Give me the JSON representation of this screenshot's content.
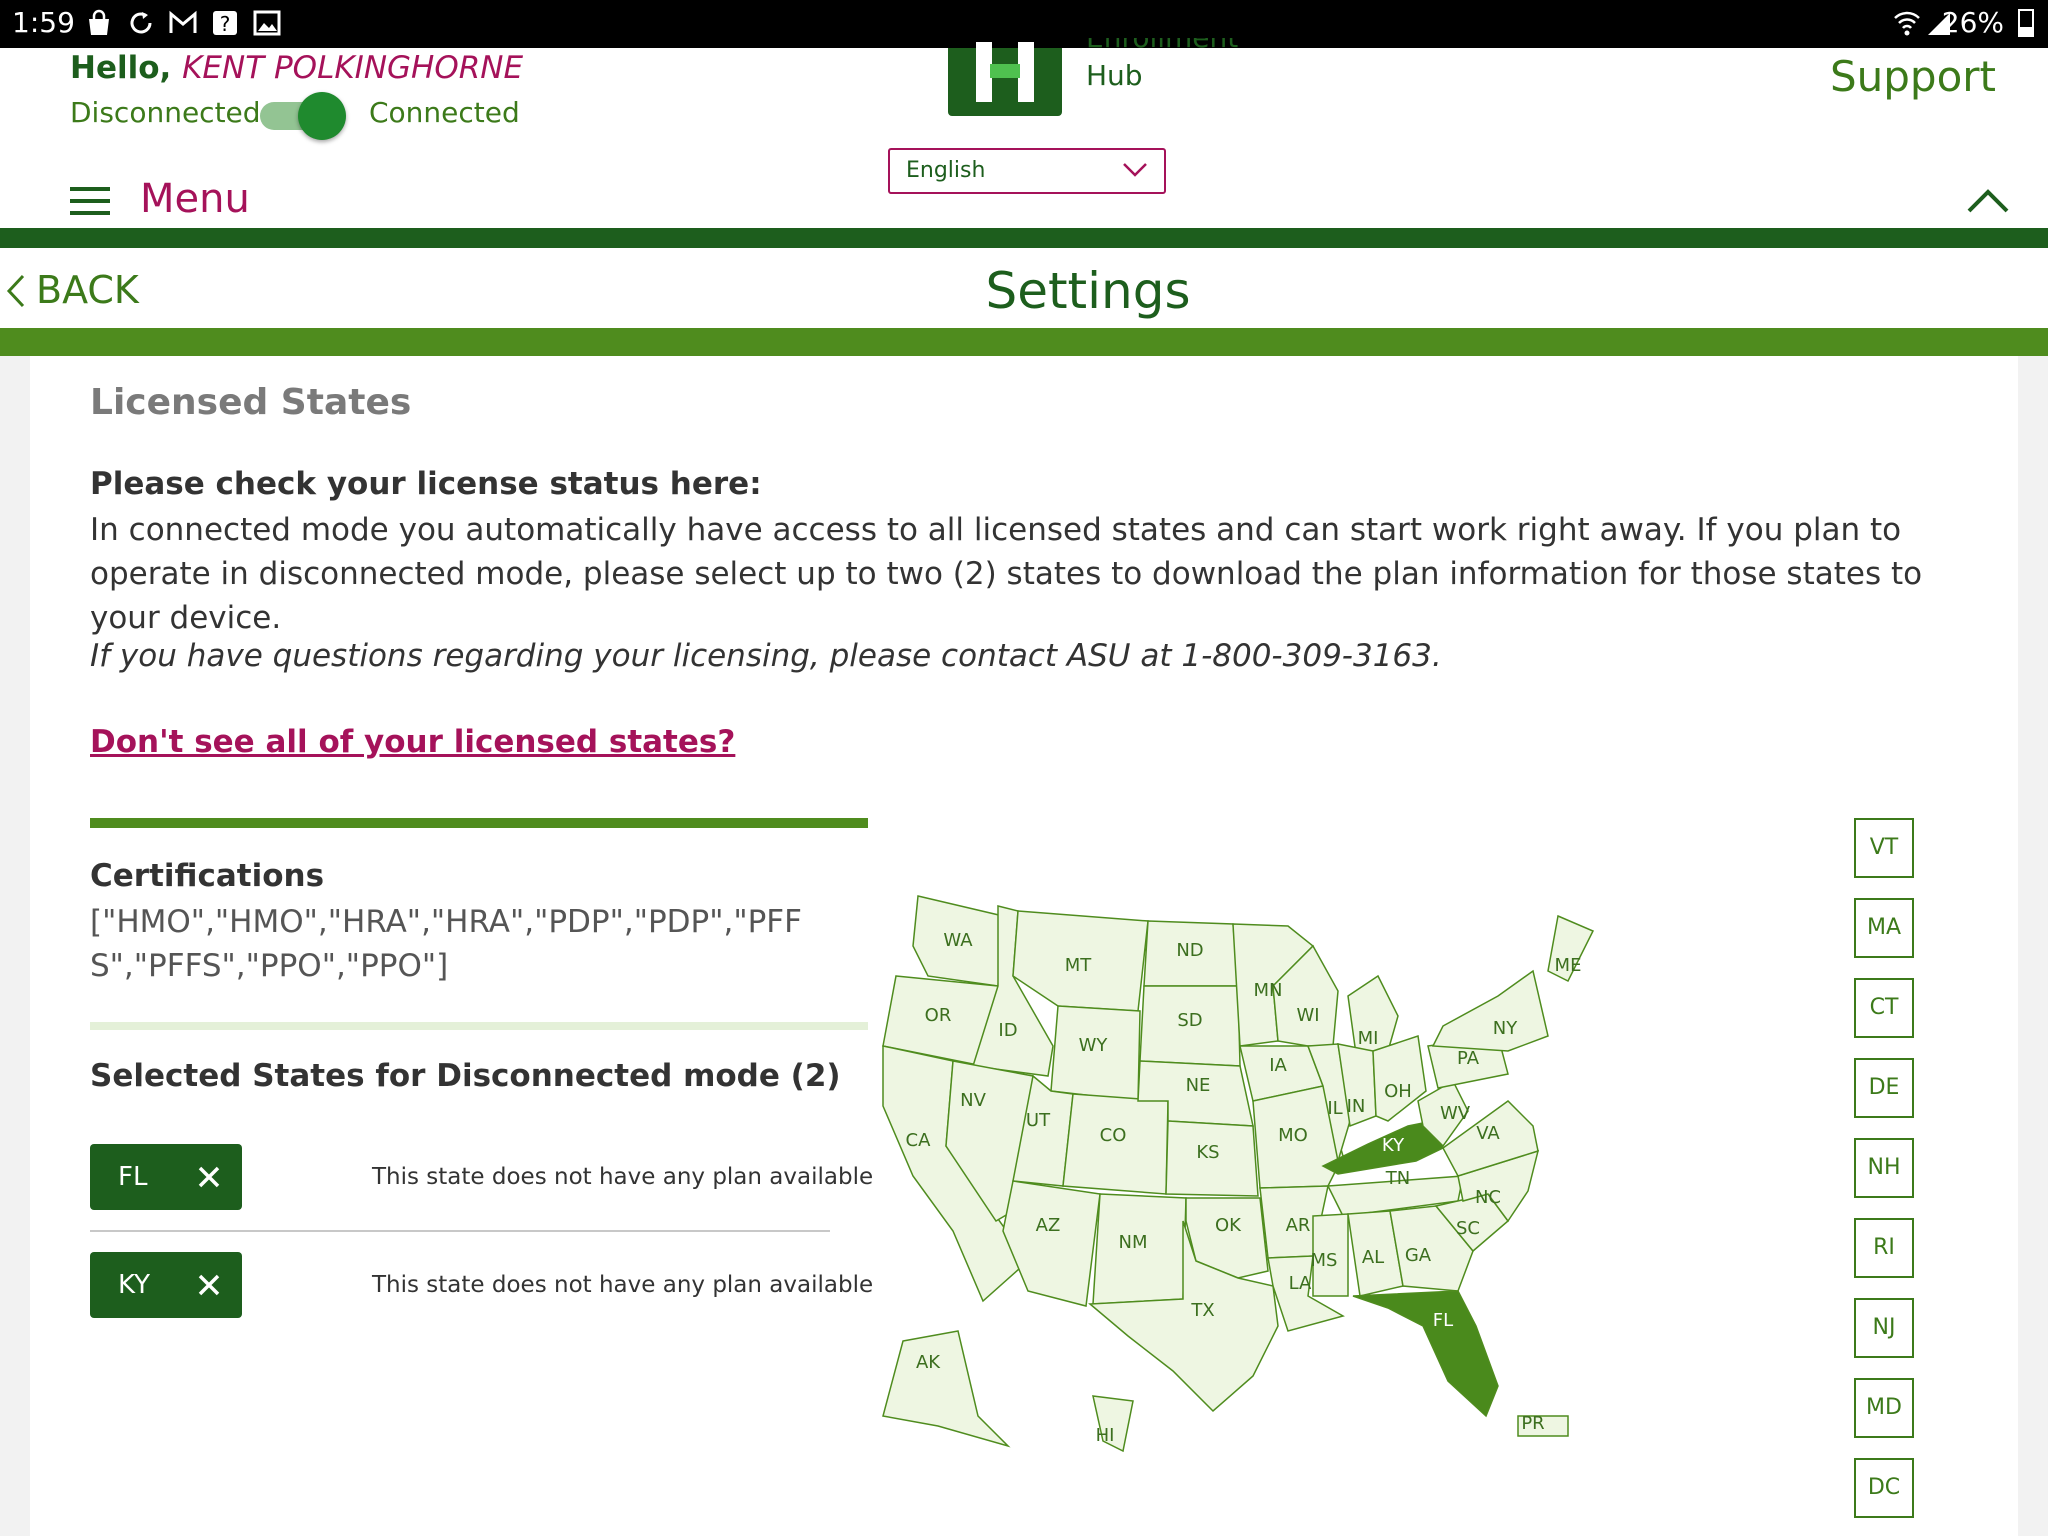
{
  "status_bar": {
    "time": "1:59",
    "battery": "26%",
    "icons": [
      "bag-icon",
      "sync-icon",
      "gmail-icon",
      "help-icon",
      "image-icon",
      "wifi-icon",
      "signal-icon",
      "battery-icon"
    ]
  },
  "header": {
    "greeting": "Hello,",
    "user_name": "KENT POLKINGHORNE",
    "disconnected_label": "Disconnected",
    "connected_label": "Connected",
    "connected_on": true,
    "logo_text_cut": "Enrollment",
    "logo_text": "Hub",
    "support_label": "Support",
    "language_selected": "English",
    "menu_label": "Menu"
  },
  "nav": {
    "back_label": "BACK",
    "page_title": "Settings"
  },
  "content": {
    "section_title": "Licensed States",
    "check_heading": "Please check your license status here:",
    "info_text": "In connected mode you automatically have access to all licensed states and can start work right away. If you plan to operate in disconnected mode, please select up to two (2) states to download the plan information for those states to your device.",
    "contact_text": "If you have questions regarding your licensing, please contact ASU at 1-800-309-3163.",
    "missing_link": "Don't see all of your licensed states?",
    "certifications_title": "Certifications",
    "certifications_value": "[\"HMO\",\"HMO\",\"HRA\",\"HRA\",\"PDP\",\"PDP\",\"PFFS\",\"PFFS\",\"PPO\",\"PPO\"]",
    "selected_title": "Selected States for Disconnected mode (2)",
    "selected_states": [
      {
        "code": "FL",
        "note": "This state does not have any plan available"
      },
      {
        "code": "KY",
        "note": "This state does not have any plan available"
      }
    ]
  },
  "map": {
    "state_labels": [
      "WA",
      "OR",
      "CA",
      "ID",
      "NV",
      "MT",
      "WY",
      "UT",
      "AZ",
      "CO",
      "NM",
      "ND",
      "SD",
      "NE",
      "KS",
      "OK",
      "TX",
      "MN",
      "IA",
      "MO",
      "AR",
      "LA",
      "WI",
      "IL",
      "MI",
      "IN",
      "OH",
      "KY",
      "TN",
      "MS",
      "AL",
      "GA",
      "FL",
      "SC",
      "NC",
      "VA",
      "WV",
      "PA",
      "NY",
      "ME",
      "AK",
      "HI",
      "PR"
    ],
    "selected": [
      "FL",
      "KY"
    ],
    "selected_color": "#4a8a1c",
    "default_color": "#eef6e2",
    "small_state_buttons": [
      "VT",
      "MA",
      "CT",
      "DE",
      "NH",
      "RI",
      "NJ",
      "MD",
      "DC"
    ]
  }
}
